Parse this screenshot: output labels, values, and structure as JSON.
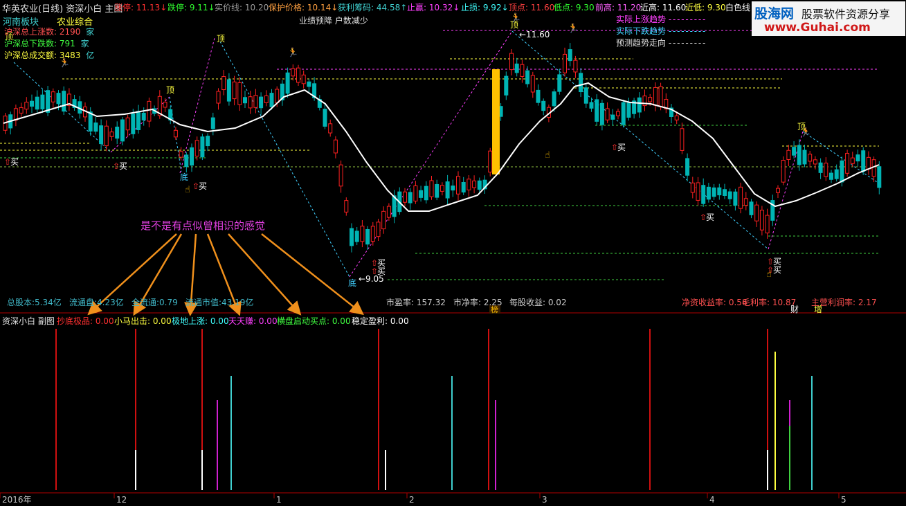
{
  "main_header": {
    "title": "华英农业(日线) 资深小白 主图",
    "items": [
      {
        "label": "涨停: 11.13↓",
        "color": "#ff3030"
      },
      {
        "label": "跌停: 9.11↓",
        "color": "#30ff30"
      },
      {
        "label": "实价线: 10.20",
        "color": "#9a9a9a"
      },
      {
        "label": "保护价格: 10.14↓",
        "color": "#ffa040"
      },
      {
        "label": "获利筹码: 44.58↑",
        "color": "#40d0d0"
      },
      {
        "label": "止赢: 10.32↓",
        "color": "#ff40ff"
      },
      {
        "label": "止损: 9.92↓",
        "color": "#40ffff"
      },
      {
        "label": "顶点: 11.60",
        "color": "#ff4040"
      },
      {
        "label": "低点: 9.30",
        "color": "#30ff30"
      },
      {
        "label": "前高: 11.20",
        "color": "#ff60ff"
      },
      {
        "label": "近高: 11.60",
        "color": "#ffffff"
      },
      {
        "label": "近低: 9.30",
        "color": "#ffff40"
      },
      {
        "label": "白色线",
        "color": "#ffffff"
      }
    ]
  },
  "watermark": {
    "brand": "股海网",
    "slogan": "股票软件资源分享",
    "url": "www.Guhai.com"
  },
  "sector": {
    "region": "河南板块",
    "industry": "农业综合"
  },
  "market_stats": [
    {
      "label": "沪深总上涨数:",
      "value": "2190",
      "unit": "家"
    },
    {
      "label": "沪深总下跌数:",
      "value": "791",
      "unit": "家"
    },
    {
      "label": "沪深总成交额:",
      "value": "3483",
      "unit": "亿"
    }
  ],
  "note_center": "业绩预降 户数减少",
  "trend_legend": [
    "实际上涨趋势",
    "实际下跌趋势",
    "预测趋势走向"
  ],
  "annotation_text": "是不是有点似曾相识的感觉",
  "markers": {
    "ding": "顶",
    "di": "底",
    "buy": "买",
    "peak_value": "11.60",
    "low_value": "9.05",
    "bang": "榜",
    "cai": "财",
    "zeng": "增"
  },
  "fundamentals": [
    {
      "label": "总股本:5.34亿",
      "color": "#40b8c8"
    },
    {
      "label": "流通盘:4.23亿",
      "color": "#40b8c8"
    },
    {
      "label": "全流通:0.79",
      "color": "#40b8c8"
    },
    {
      "label": "流通市值:43.19亿",
      "color": "#40b8c8"
    },
    {
      "label": "市盈率: 157.32",
      "color": "#cccccc"
    },
    {
      "label": "市净率: 2.25",
      "color": "#cccccc"
    },
    {
      "label": "每股收益: 0.02",
      "color": "#cccccc"
    },
    {
      "label": "净资收益率: 0.56",
      "color": "#ff5050"
    },
    {
      "label": "毛利率: 10.87",
      "color": "#ff5050"
    },
    {
      "label": "主营利润率: 2.17",
      "color": "#ff5050"
    }
  ],
  "sub_header": {
    "title": "资深小白 副图",
    "items": [
      {
        "label": "抄底极品: 0.00",
        "color": "#ff3030"
      },
      {
        "label": "小马出击: 0.00",
        "color": "#ffff40"
      },
      {
        "label": "极地上涨: 0.00",
        "color": "#40ffff"
      },
      {
        "label": "天天赚: 0.00",
        "color": "#ff40ff"
      },
      {
        "label": "横盘启动买点: 0.00",
        "color": "#40ff40"
      },
      {
        "label": "稳定盈利: 0.00",
        "color": "#ffffff"
      }
    ]
  },
  "time_axis": [
    "2016年",
    "12",
    "1",
    "2",
    "3",
    "4",
    "5"
  ],
  "colors": {
    "up": "#ff2020",
    "down": "#00b4b4",
    "ma": "#ffffff",
    "axis": "#b00000"
  }
}
